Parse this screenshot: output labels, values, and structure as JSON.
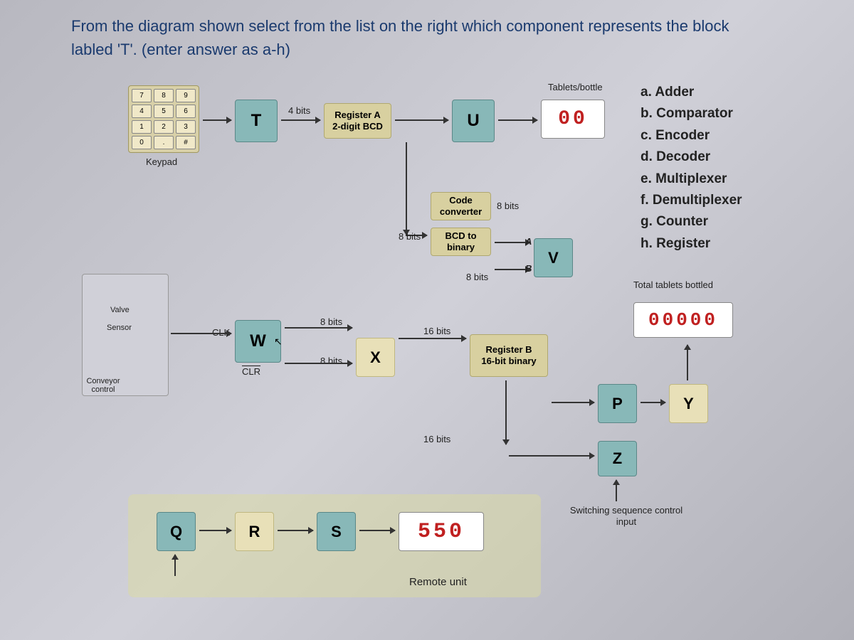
{
  "question": {
    "line1": "From the diagram shown select from the list on the right which component represents the block",
    "line2": "labled 'T'. (enter answer as a-h)"
  },
  "keypad": {
    "keys": [
      "7",
      "8",
      "9",
      "4",
      "5",
      "6",
      "1",
      "2",
      "3",
      "0",
      ".",
      "#"
    ],
    "label": "Keypad"
  },
  "blocks": {
    "T": "T",
    "U": "U",
    "V": "V",
    "W": "W",
    "X": "X",
    "Y": "Y",
    "Z": "Z",
    "P": "P",
    "Q": "Q",
    "R": "R",
    "S": "S",
    "registerA": "Register A",
    "registerA2": "2-digit BCD",
    "codeconv": "Code converter",
    "bcd": "BCD to binary",
    "registerB": "Register B",
    "registerB2": "16-bit binary"
  },
  "displays": {
    "tablets": "00",
    "total": "00000",
    "remote": "550"
  },
  "labels": {
    "tabletsBottle": "Tablets/bottle",
    "totalTablets": "Total tablets bottled",
    "switching": "Switching sequence control input",
    "remoteUnit": "Remote unit",
    "valve": "Valve",
    "sensor": "Sensor",
    "conveyor": "Conveyor control",
    "clk": "CLK",
    "clr": "CLR",
    "fourBits": "4 bits",
    "eightBits": "8 bits",
    "sixteenBits": "16 bits",
    "a": "A",
    "b": "B"
  },
  "answers": {
    "a": "a. Adder",
    "b": "b. Comparator",
    "c": "c. Encoder",
    "d": "d. Decoder",
    "e": "e. Multiplexer",
    "f": "f. Demultiplexer",
    "g": "g. Counter",
    "h": "h. Register"
  }
}
